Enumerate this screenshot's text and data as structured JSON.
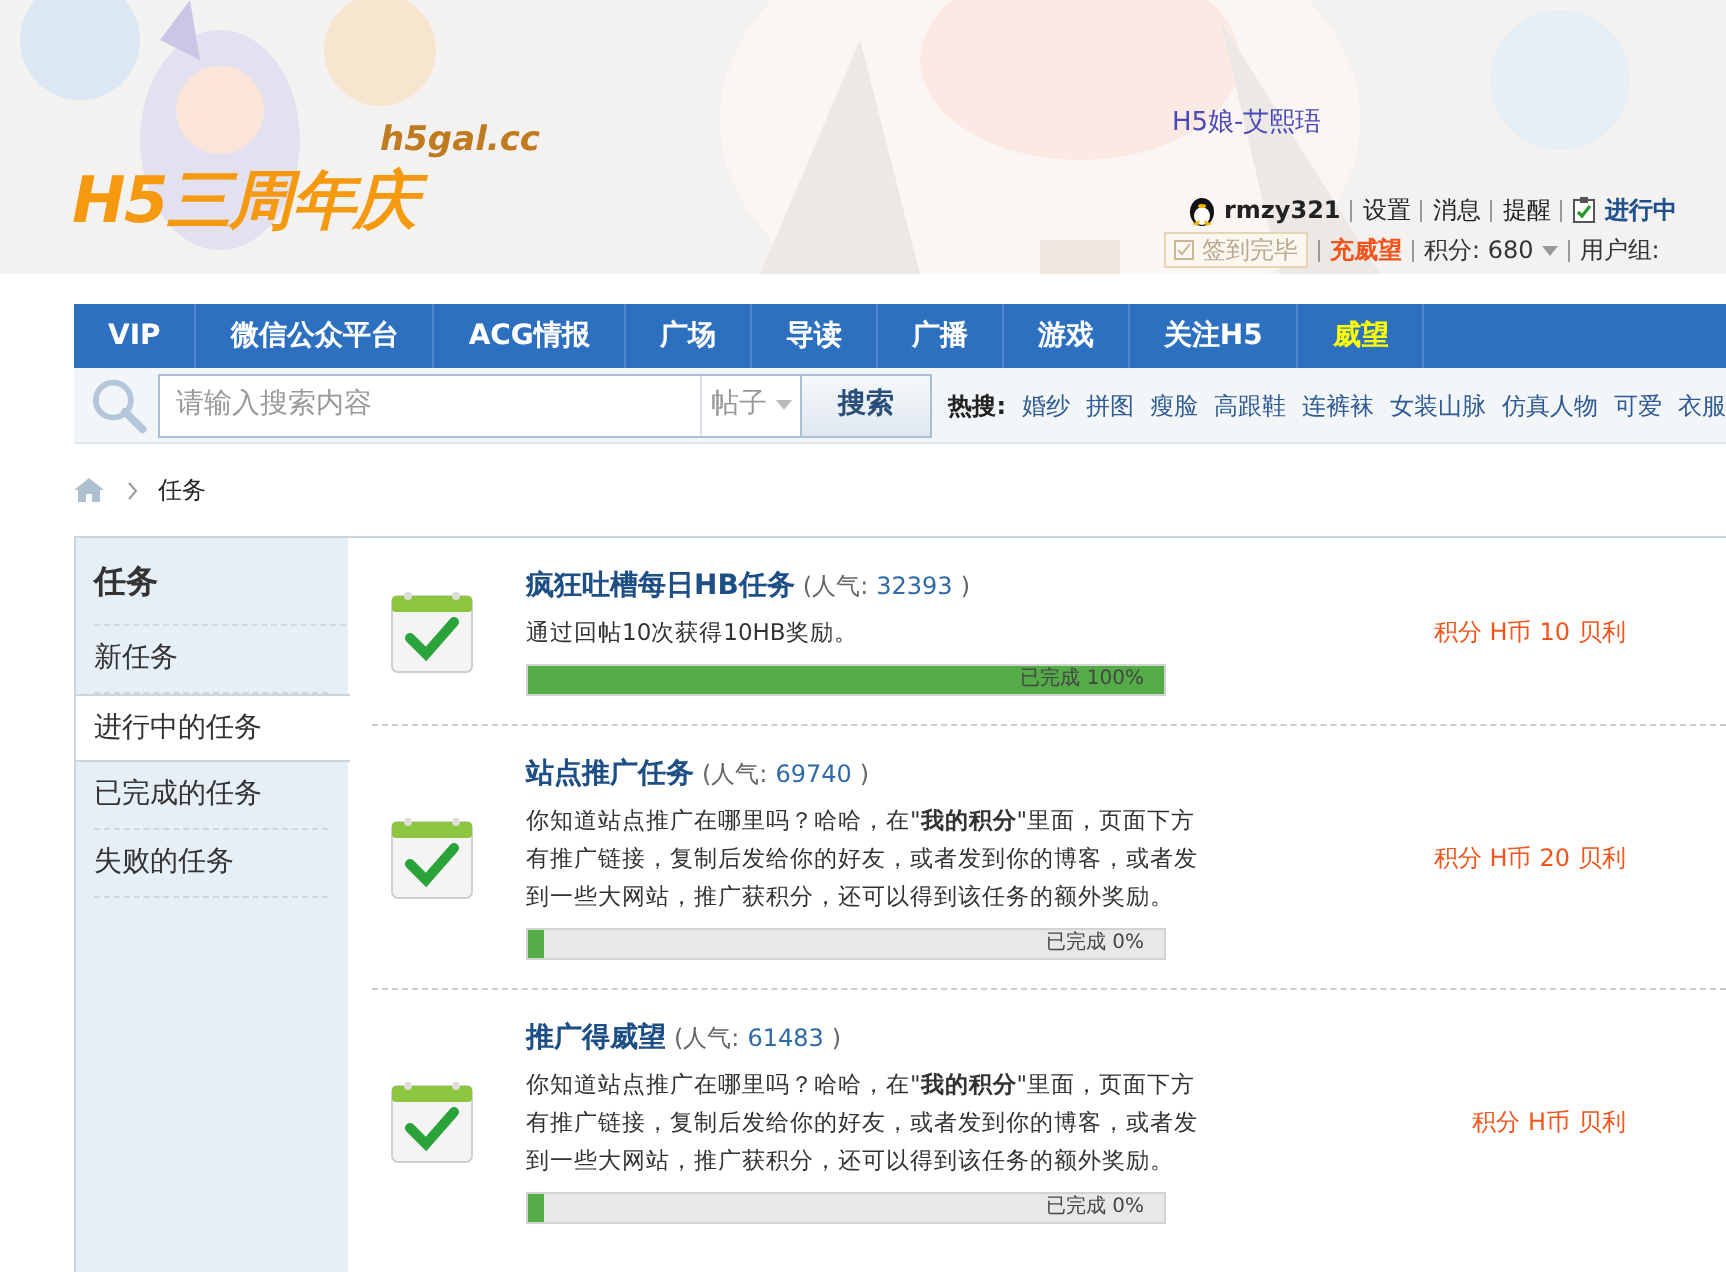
{
  "header": {
    "logo_domain": "h5gal.cc",
    "logo_title": "H5三周年庆",
    "mascot_caption": "H5娘-艾熙珸"
  },
  "user_bar": {
    "username": "rmzy321",
    "links": [
      "设置",
      "消息",
      "提醒"
    ],
    "tasks_link": "进行中",
    "checkin_button": "签到完毕",
    "prestige_link": "充威望",
    "points": "积分: 680",
    "group_label": "用户组:"
  },
  "nav": [
    {
      "label": "VIP",
      "highlight": false
    },
    {
      "label": "微信公众平台",
      "highlight": false
    },
    {
      "label": "ACG情报",
      "highlight": false
    },
    {
      "label": "广场",
      "highlight": false
    },
    {
      "label": "导读",
      "highlight": false
    },
    {
      "label": "广播",
      "highlight": false
    },
    {
      "label": "游戏",
      "highlight": false
    },
    {
      "label": "关注H5",
      "highlight": false
    },
    {
      "label": "威望",
      "highlight": true
    }
  ],
  "search": {
    "placeholder": "请输入搜索内容",
    "scope": "帖子",
    "button": "搜索",
    "hot_label": "热搜:",
    "hot_terms": [
      "婚纱",
      "拼图",
      "瘦脸",
      "高跟鞋",
      "连裤袜",
      "女装山脉",
      "仿真人物",
      "可爱",
      "衣服"
    ]
  },
  "breadcrumb": [
    "任务"
  ],
  "sidebar": {
    "title": "任务",
    "items": [
      {
        "label": "新任务",
        "selected": false
      },
      {
        "label": "进行中的任务",
        "selected": true
      },
      {
        "label": "已完成的任务",
        "selected": false
      },
      {
        "label": "失败的任务",
        "selected": false
      }
    ]
  },
  "tasks": [
    {
      "title": "疯狂吐槽每日HB任务",
      "popularity_label": "(人气:",
      "popularity": "32393",
      "popularity_close": ")",
      "description": "通过回帖10次获得10HB奖励。",
      "progress_text": "已完成 100%",
      "level": 1,
      "reward_label": "积分 H币",
      "reward_amount": "10",
      "reward_unit": "贝利"
    },
    {
      "title": "站点推广任务",
      "popularity_label": "(人气:",
      "popularity": "69740",
      "popularity_close": ")",
      "description": "你知道站点推广在哪里吗？哈哈，在\"**我的积分**\"里面，页面下方有推广链接，复制后发给你的好友，或者发到你的博客，或者发到一些大网站，推广获积分，还可以得到该任务的额外奖励。",
      "progress_text": "已完成 0%",
      "level": 0,
      "reward_label": "积分 H币",
      "reward_amount": "20",
      "reward_unit": "贝利"
    },
    {
      "title": "推广得威望",
      "popularity_label": "(人气:",
      "popularity": "61483",
      "popularity_close": ")",
      "description": "你知道站点推广在哪里吗？哈哈，在\"**我的积分**\"里面，页面下方有推广链接，复制后发给你的好友，或者发到你的博客，或者发到一些大网站，推广获积分，还可以得到该任务的额外奖励。",
      "progress_text": "已完成 0%",
      "level": 0,
      "reward_label": "积分 H币",
      "reward_unit": "贝利"
    }
  ]
}
